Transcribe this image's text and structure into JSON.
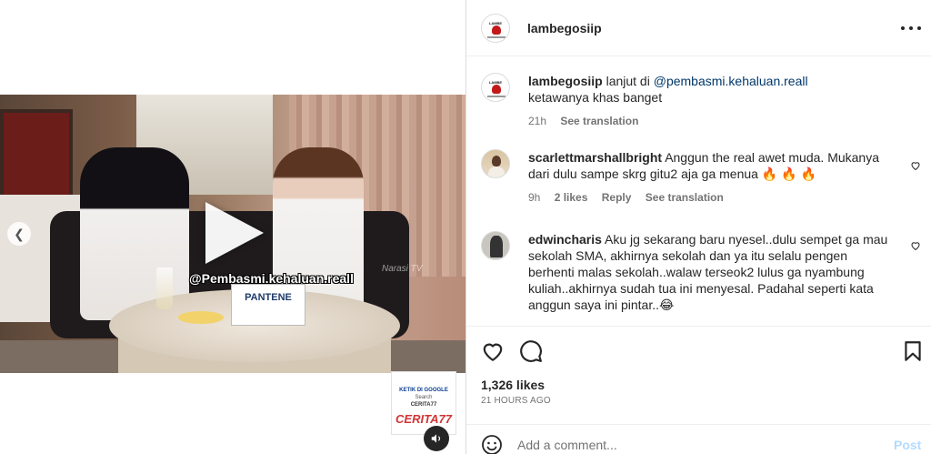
{
  "video": {
    "watermark": "@Pembasmi.kehaluan.reall",
    "sign": "PANTENE",
    "corner_tag": "Narasi TV"
  },
  "ad": {
    "line1": "KETIK DI GOOGLE",
    "line2": "Search",
    "line3": "CERITA77",
    "line4": "CERITA77"
  },
  "header": {
    "username": "lambegosiip"
  },
  "caption": {
    "username": "lambegosiip",
    "text_prefix": "lanjut di",
    "mention": "@pembasmi.kehaluan.reall",
    "line2": "ketawanya khas banget",
    "time": "21h",
    "see_translation": "See translation"
  },
  "comments": [
    {
      "username": "scarlettmarshallbright",
      "text": "Anggun the real awet muda. Mukanya dari dulu sampe skrg gitu2 aja ga menua 🔥 🔥 🔥",
      "time": "9h",
      "likes": "2 likes",
      "reply": "Reply",
      "see_translation": "See translation"
    },
    {
      "username": "edwincharis",
      "text": "Aku jg sekarang baru nyesel..dulu sempet ga mau sekolah SMA, akhirnya sekolah dan ya itu selalu pengen berhenti malas sekolah..walaw terseok2 lulus ga nyambung kuliah..akhirnya sudah tua ini menyesal. Padahal seperti kata anggun saya ini pintar..😂"
    }
  ],
  "post": {
    "likes": "1,326 likes",
    "time": "21 HOURS AGO"
  },
  "add_comment": {
    "placeholder": "Add a comment...",
    "post_label": "Post"
  },
  "colors": {
    "link": "#00376b",
    "muted": "#737373",
    "post_disabled": "#b3dbff"
  }
}
